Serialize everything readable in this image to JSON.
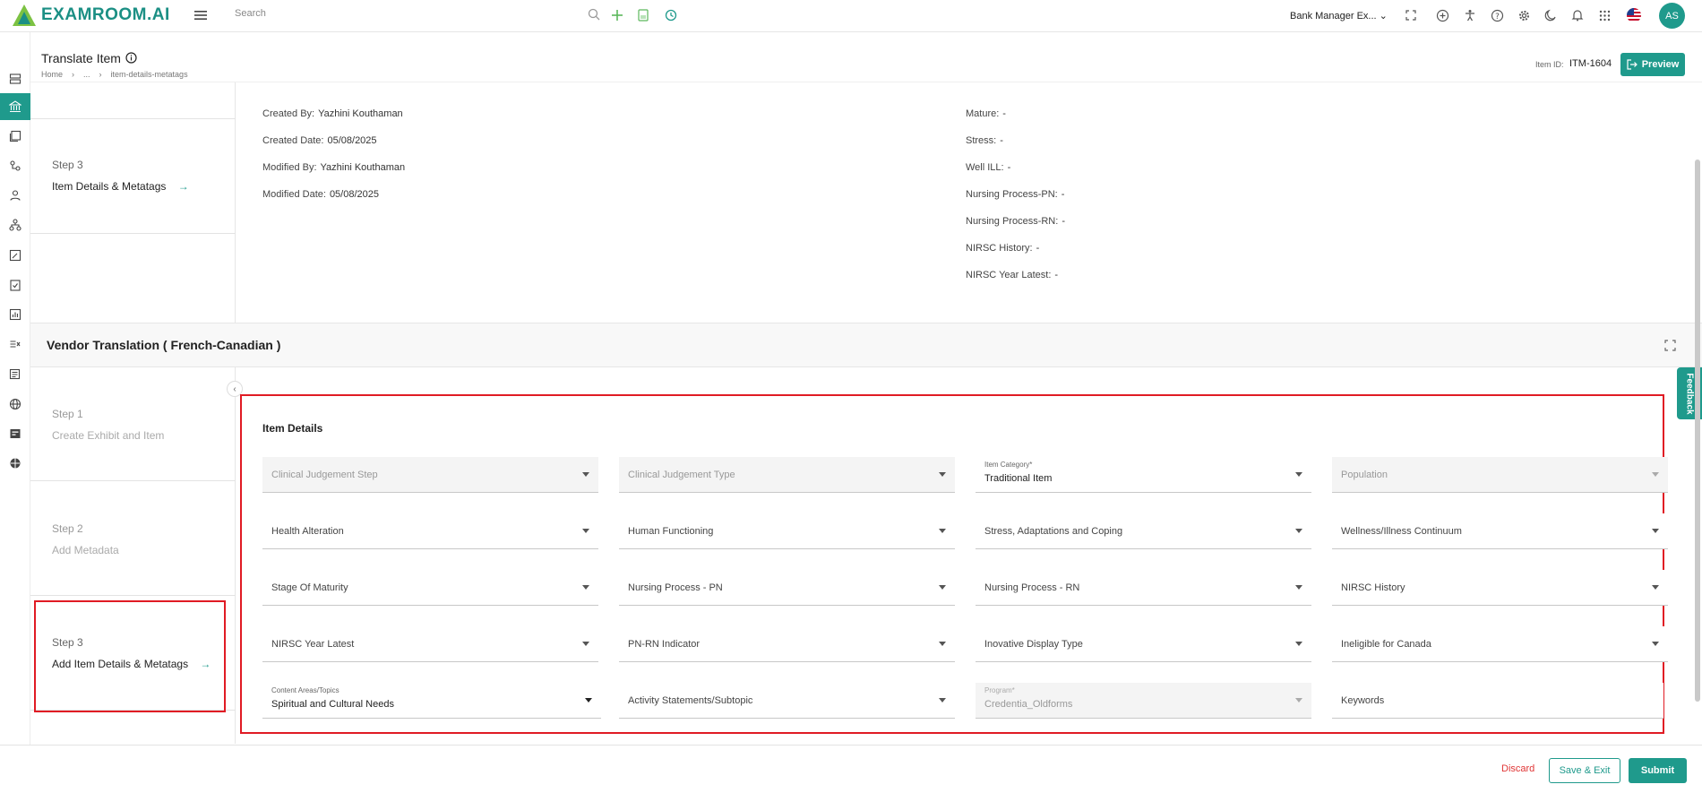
{
  "app": {
    "logo_text": "EXAMROOM.AI"
  },
  "topbar": {
    "search_placeholder": "Search",
    "role": "Bank Manager Ex...",
    "avatar_initials": "AS",
    "accent_color": "#1f9a8c"
  },
  "header": {
    "title": "Translate Item",
    "breadcrumb": [
      "Home",
      "...",
      "item-details-metatags"
    ],
    "item_id_label": "Item ID:",
    "item_id": "ITM-1604",
    "preview_label": "Preview"
  },
  "top_steps": {
    "step3_label": "Step 3",
    "step3_text": "Item Details & Metatags"
  },
  "metadata_left": [
    {
      "label": "Created By:",
      "value": "Yazhini Kouthaman"
    },
    {
      "label": "Created Date:",
      "value": "05/08/2025"
    },
    {
      "label": "Modified By:",
      "value": "Yazhini Kouthaman"
    },
    {
      "label": "Modified Date:",
      "value": "05/08/2025"
    }
  ],
  "metadata_right": [
    {
      "label": "Mature:",
      "value": "-"
    },
    {
      "label": "Stress:",
      "value": "-"
    },
    {
      "label": "Well ILL:",
      "value": "-"
    },
    {
      "label": "Nursing Process-PN:",
      "value": "-"
    },
    {
      "label": "Nursing Process-RN:",
      "value": "-"
    },
    {
      "label": "NIRSC History:",
      "value": "-"
    },
    {
      "label": "NIRSC Year Latest:",
      "value": "-"
    }
  ],
  "vendor": {
    "title": "Vendor Translation ( French-Canadian )"
  },
  "steps": [
    {
      "label": "Step 1",
      "text": "Create Exhibit and Item"
    },
    {
      "label": "Step 2",
      "text": "Add Metadata"
    },
    {
      "label": "Step 3",
      "text": "Add Item Details & Metatags"
    }
  ],
  "form": {
    "title": "Item Details",
    "fields": {
      "clinical_judgement_step": "Clinical Judgement Step",
      "clinical_judgement_type": "Clinical Judgement Type",
      "item_category_label": "Item Category*",
      "item_category_value": "Traditional Item",
      "population": "Population",
      "health_alteration": "Health Alteration",
      "human_functioning": "Human Functioning",
      "stress_adaptations": "Stress, Adaptations and Coping",
      "wellness_illness": "Wellness/Illness Continuum",
      "stage_of_maturity": "Stage Of Maturity",
      "nursing_process_pn": "Nursing Process - PN",
      "nursing_process_rn": "Nursing Process - RN",
      "nirsc_history": "NIRSC History",
      "nirsc_year_latest": "NIRSC Year Latest",
      "pn_rn_indicator": "PN-RN Indicator",
      "inovative_display_type": "Inovative Display Type",
      "ineligible_for_canada": "Ineligible for Canada",
      "content_areas_label": "Content Areas/Topics",
      "content_areas_value": "Spiritual and Cultural Needs",
      "activity_statements": "Activity Statements/Subtopic",
      "program_label": "Program*",
      "program_value": "Credentia_Oldforms",
      "keywords": "Keywords"
    }
  },
  "feedback_label": "Feedback",
  "footer": {
    "discard": "Discard",
    "save_exit": "Save & Exit",
    "submit": "Submit"
  }
}
